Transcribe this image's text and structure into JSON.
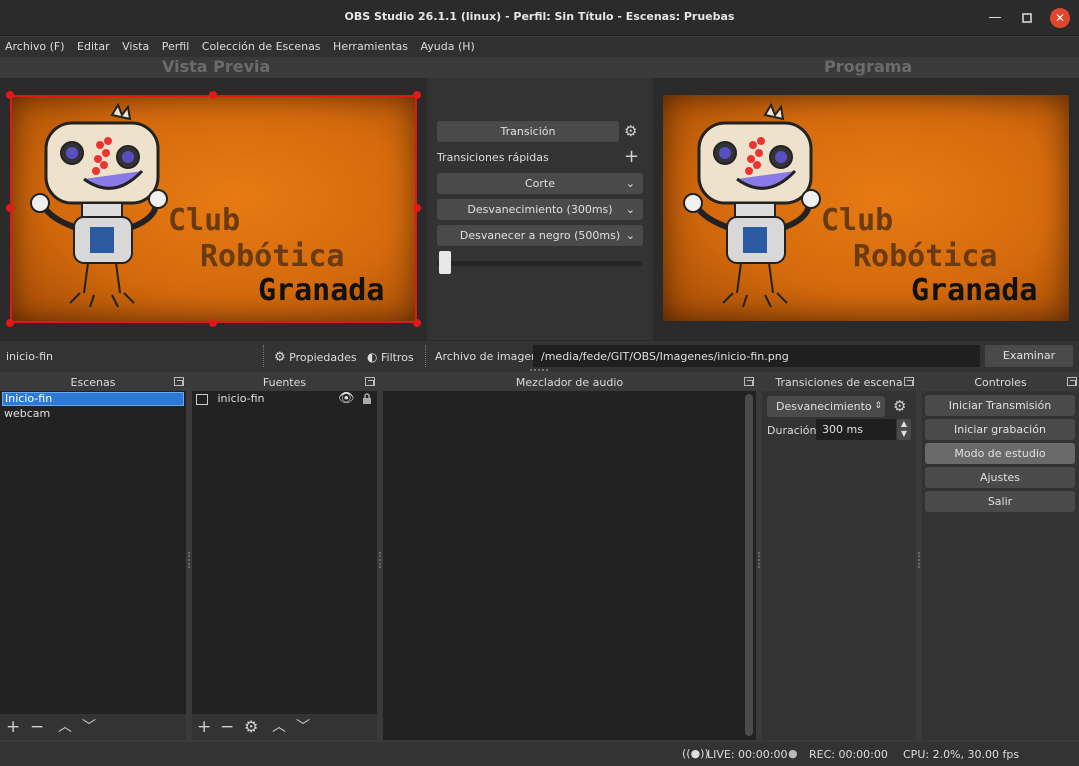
{
  "window": {
    "title": "OBS Studio 26.1.1 (linux) - Perfil: Sin Título - Escenas: Pruebas",
    "minimize_icon": "minimize-icon",
    "maximize_icon": "maximize-icon",
    "close_icon": "close-icon"
  },
  "menu": [
    "Archivo (F)",
    "Editar",
    "Vista",
    "Perfil",
    "Colección de Escenas",
    "Herramientas",
    "Ayuda (H)"
  ],
  "preview": {
    "label": "Vista Previa",
    "logo_lines": [
      "Club",
      "Robótica",
      "Granada"
    ]
  },
  "program": {
    "label": "Programa",
    "logo_lines": [
      "Club",
      "Robótica",
      "Granada"
    ]
  },
  "transitions_panel": {
    "transition_button": "Transición",
    "quick_label": "Transiciones rápidas",
    "items": [
      "Corte",
      "Desvanecimiento (300ms)",
      "Desvanecer a negro (500ms)"
    ],
    "tbar_position": 0
  },
  "source_toolbar": {
    "source_name": "inicio-fin",
    "properties": "Propiedades",
    "filters": "Filtros",
    "file_label": "Archivo de imagen",
    "file_path": "/media/fede/GIT/OBS/Imagenes/inicio-fin.png",
    "browse": "Examinar"
  },
  "docks": {
    "scenes": {
      "title": "Escenas",
      "items": [
        "Inicio-fin",
        "webcam"
      ],
      "selected": 0
    },
    "sources": {
      "title": "Fuentes",
      "items": [
        {
          "name": "inicio-fin",
          "icon": "image-icon",
          "visible": true,
          "locked": true
        }
      ]
    },
    "mixer": {
      "title": "Mezclador de audio"
    },
    "scene_transitions": {
      "title": "Transiciones de escena",
      "selected": "Desvanecimiento",
      "duration_label": "Duración",
      "duration_value": "300 ms"
    },
    "controls": {
      "title": "Controles",
      "buttons": [
        "Iniciar Transmisión",
        "Iniciar grabación",
        "Modo de estudio",
        "Ajustes",
        "Salir"
      ],
      "active": 2
    }
  },
  "status": {
    "live": "LIVE: 00:00:00",
    "rec": "REC: 00:00:00",
    "cpu": "CPU: 2.0%, 30.00 fps"
  },
  "colors": {
    "selection_border": "#e01818",
    "selected_item": "#2c7ad6",
    "close_button": "#e0452d",
    "scene_background": "#d46a0d"
  }
}
